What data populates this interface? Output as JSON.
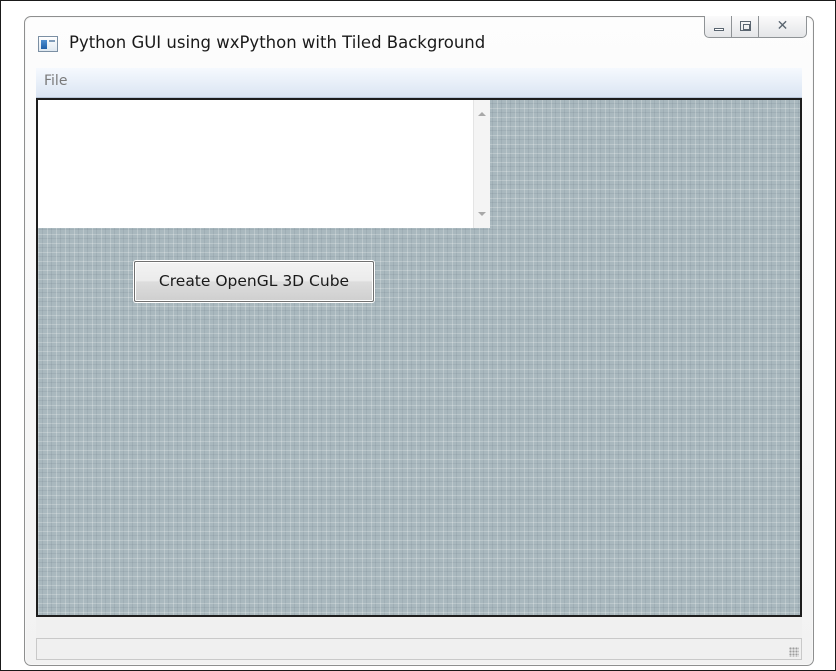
{
  "window": {
    "title": "Python GUI using wxPython with Tiled Background",
    "close_glyph": "✕"
  },
  "menubar": {
    "items": [
      "File"
    ]
  },
  "main": {
    "text_area_value": "",
    "button_label": "Create OpenGL 3D Cube"
  },
  "icons": {
    "app": "app-icon",
    "minimize": "minimize-icon",
    "maximize": "maximize-icon",
    "close": "close-icon",
    "scroll_up": "chevron-up-icon",
    "scroll_down": "chevron-down-icon",
    "resize_grip": "resize-grip-icon"
  },
  "colors": {
    "tiled_background": "#a9b8be",
    "menubar": "#dbe5f3"
  }
}
